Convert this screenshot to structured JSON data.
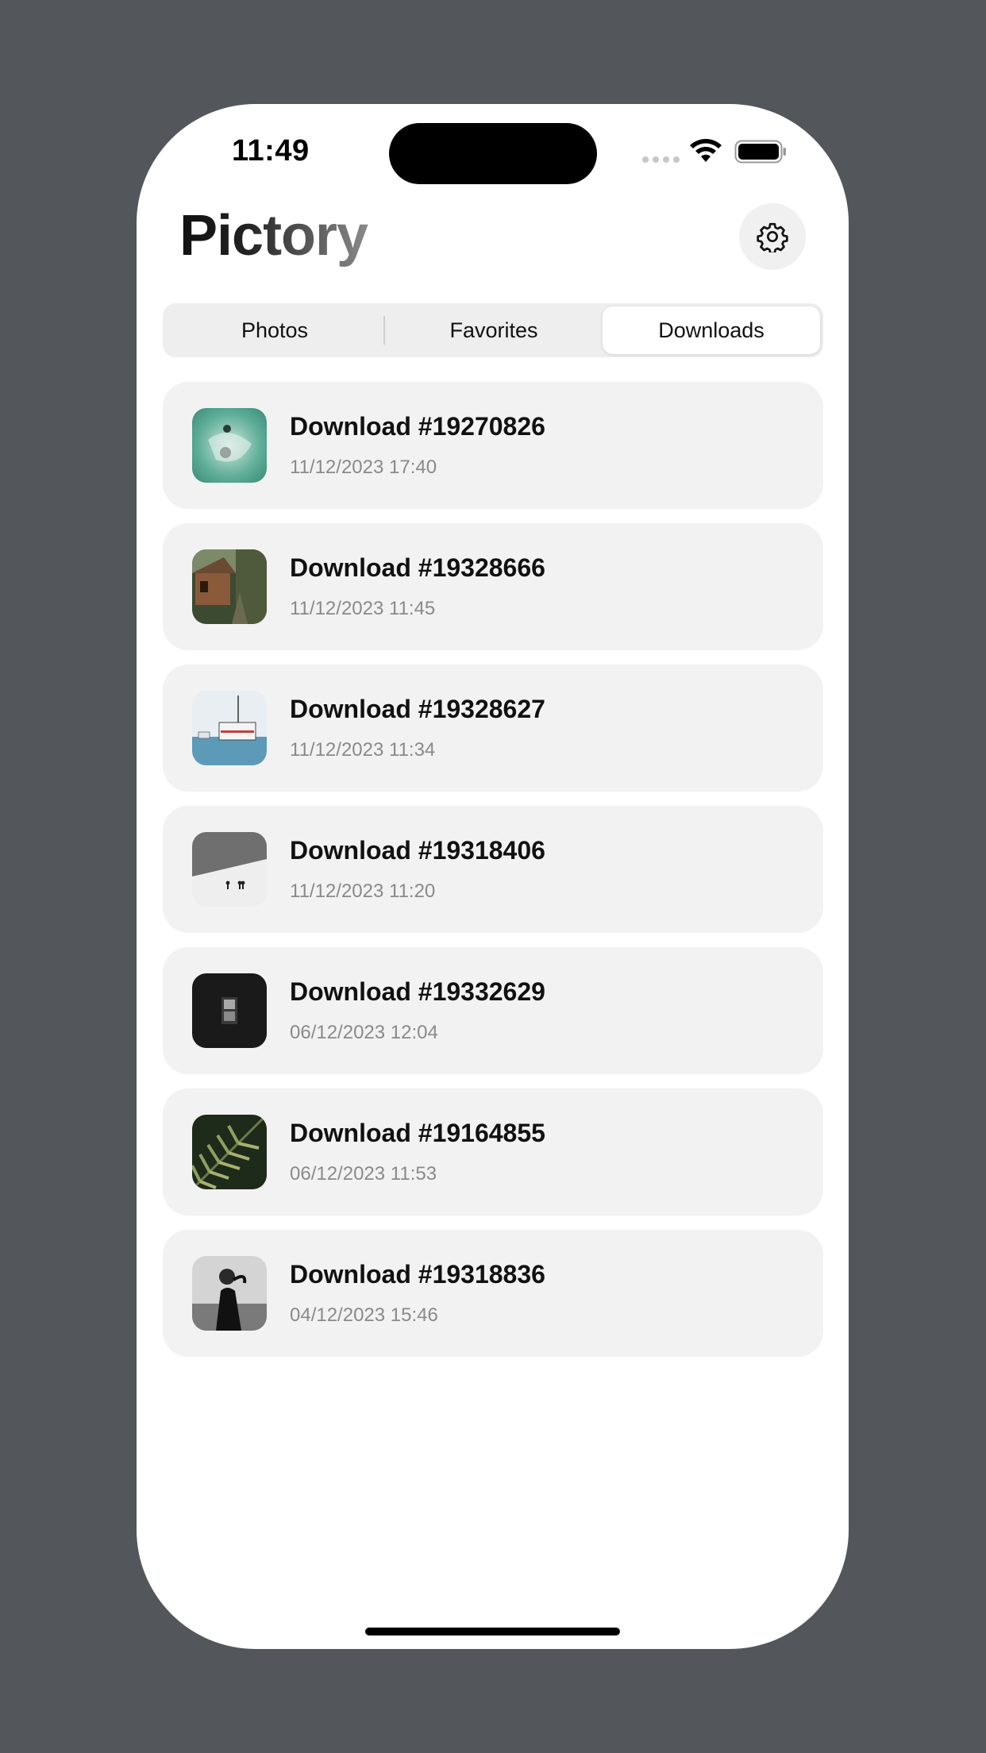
{
  "status_bar": {
    "time": "11:49"
  },
  "header": {
    "title": "Pictory",
    "settings_icon": "gear-icon"
  },
  "tabs": [
    {
      "label": "Photos",
      "active": false
    },
    {
      "label": "Favorites",
      "active": false
    },
    {
      "label": "Downloads",
      "active": true
    }
  ],
  "downloads": [
    {
      "title": "Download #19270826",
      "date": "11/12/2023 17:40",
      "thumbnail": "swimmers-in-sea"
    },
    {
      "title": "Download #19328666",
      "date": "11/12/2023 11:45",
      "thumbnail": "forest-cabin"
    },
    {
      "title": "Download #19328627",
      "date": "11/12/2023 11:34",
      "thumbnail": "ferry-boat"
    },
    {
      "title": "Download #19318406",
      "date": "11/12/2023 11:20",
      "thumbnail": "snow-slope-people"
    },
    {
      "title": "Download #19332629",
      "date": "06/12/2023 12:04",
      "thumbnail": "dark-window"
    },
    {
      "title": "Download #19164855",
      "date": "06/12/2023 11:53",
      "thumbnail": "palm-leaves"
    },
    {
      "title": "Download #19318836",
      "date": "04/12/2023 15:46",
      "thumbnail": "bw-portrait"
    }
  ]
}
